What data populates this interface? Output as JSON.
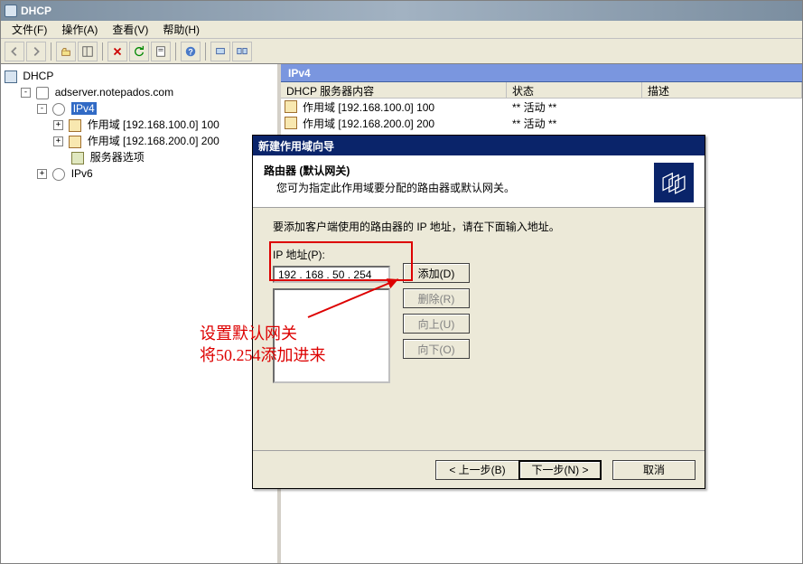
{
  "titlebar": {
    "title": "DHCP"
  },
  "menu": {
    "file": "文件(F)",
    "action": "操作(A)",
    "view": "查看(V)",
    "help": "帮助(H)"
  },
  "tree": {
    "root": "DHCP",
    "server": "adserver.notepados.com",
    "ipv4": "IPv4",
    "scope1": "作用域 [192.168.100.0] 100",
    "scope2": "作用域 [192.168.200.0] 200",
    "options": "服务器选项",
    "ipv6": "IPv6"
  },
  "list": {
    "heading": "IPv4",
    "cols": {
      "c0": "DHCP 服务器内容",
      "c1": "状态",
      "c2": "描述"
    },
    "rows": [
      {
        "name": "作用域 [192.168.100.0] 100",
        "state": "** 活动 **"
      },
      {
        "name": "作用域 [192.168.200.0] 200",
        "state": "** 活动 **"
      }
    ]
  },
  "wizard": {
    "title": "新建作用域向导",
    "head": "路由器 (默认网关)",
    "desc": "您可为指定此作用域要分配的路由器或默认网关。",
    "instr": "要添加客户端使用的路由器的 IP 地址，请在下面输入地址。",
    "iplabel": "IP 地址(P):",
    "ipvalue": "192 . 168 .  50 . 254",
    "buttons": {
      "add": "添加(D)",
      "del": "删除(R)",
      "up": "向上(U)",
      "down": "向下(O)"
    },
    "nav": {
      "back": "< 上一步(B)",
      "next": "下一步(N) >",
      "cancel": "取消"
    }
  },
  "annotation": {
    "line1": "设置默认网关",
    "line2": "将50.254添加进来"
  }
}
